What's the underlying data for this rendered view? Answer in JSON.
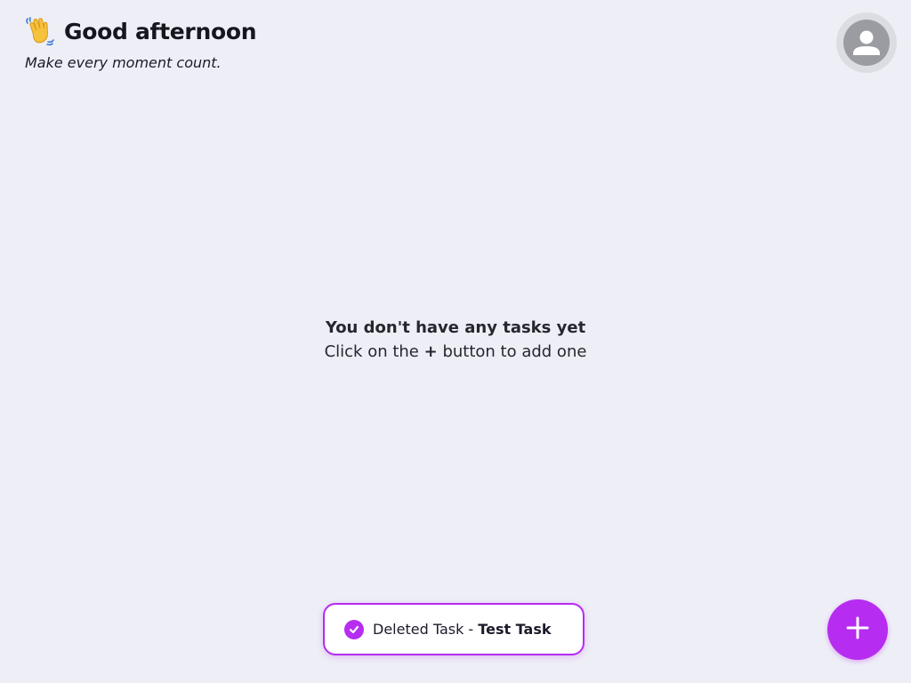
{
  "header": {
    "greeting": "Good afternoon",
    "subtitle": "Make every moment count.",
    "greeting_icon": "waving-hand-icon"
  },
  "profile": {
    "icon": "user-avatar-icon"
  },
  "empty_state": {
    "title": "You don't have any tasks yet",
    "hint_prefix": "Click on the",
    "hint_plus": "+",
    "hint_suffix": "button to add one"
  },
  "toast": {
    "icon": "check-circle-icon",
    "message": "Deleted Task -",
    "task_name": "Test Task"
  },
  "fab": {
    "icon": "plus-icon"
  },
  "colors": {
    "accent": "#b62cf0",
    "background": "#eeeff6",
    "avatar_ring": "#dcdde2",
    "avatar_fill": "#9b9ca1"
  }
}
